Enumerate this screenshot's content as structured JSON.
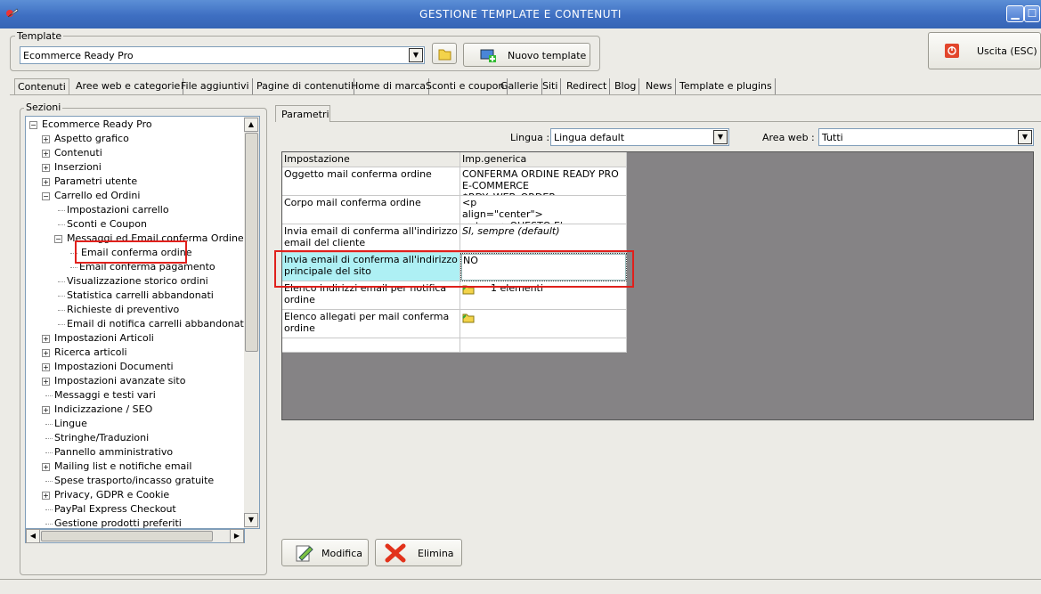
{
  "window": {
    "title": "GESTIONE TEMPLATE E CONTENUTI"
  },
  "template": {
    "group_label": "Template",
    "selected": "Ecommerce Ready Pro",
    "new_button": "Nuovo template"
  },
  "exit_button": "Uscita (ESC)",
  "tabs": [
    "Contenuti",
    "Aree web e categorie",
    "File aggiuntivi",
    "Pagine di contenuti",
    "Home di marca",
    "Sconti e coupon",
    "Gallerie",
    "Siti",
    "Redirect",
    "Blog",
    "News",
    "Template e plugins"
  ],
  "sections": {
    "label": "Sezioni",
    "tree": [
      {
        "label": "Ecommerce Ready Pro",
        "level": 0,
        "expander": "-"
      },
      {
        "label": "Aspetto grafico",
        "level": 1,
        "expander": "+"
      },
      {
        "label": "Contenuti",
        "level": 1,
        "expander": "+"
      },
      {
        "label": "Inserzioni",
        "level": 1,
        "expander": "+"
      },
      {
        "label": "Parametri utente",
        "level": 1,
        "expander": "+"
      },
      {
        "label": "Carrello ed Ordini",
        "level": 1,
        "expander": "-"
      },
      {
        "label": "Impostazioni carrello",
        "level": 2,
        "expander": ""
      },
      {
        "label": "Sconti e Coupon",
        "level": 2,
        "expander": ""
      },
      {
        "label": "Messaggi ed Email conferma Ordine",
        "level": 2,
        "expander": "-"
      },
      {
        "label": "Email conferma ordine",
        "level": 3,
        "expander": "",
        "selected": true
      },
      {
        "label": "Email conferma pagamento",
        "level": 3,
        "expander": ""
      },
      {
        "label": "Visualizzazione storico ordini",
        "level": 2,
        "expander": ""
      },
      {
        "label": "Statistica carrelli abbandonati",
        "level": 2,
        "expander": ""
      },
      {
        "label": "Richieste di preventivo",
        "level": 2,
        "expander": ""
      },
      {
        "label": "Email di notifica carrelli abbandonati",
        "level": 2,
        "expander": ""
      },
      {
        "label": "Impostazioni Articoli",
        "level": 1,
        "expander": "+"
      },
      {
        "label": "Ricerca articoli",
        "level": 1,
        "expander": "+"
      },
      {
        "label": "Impostazioni Documenti",
        "level": 1,
        "expander": "+"
      },
      {
        "label": "Impostazioni avanzate sito",
        "level": 1,
        "expander": "+"
      },
      {
        "label": "Messaggi e testi vari",
        "level": 1,
        "expander": ""
      },
      {
        "label": "Indicizzazione / SEO",
        "level": 1,
        "expander": "+"
      },
      {
        "label": "Lingue",
        "level": 1,
        "expander": ""
      },
      {
        "label": "Stringhe/Traduzioni",
        "level": 1,
        "expander": ""
      },
      {
        "label": "Pannello amministrativo",
        "level": 1,
        "expander": ""
      },
      {
        "label": "Mailing list e notifiche email",
        "level": 1,
        "expander": "+"
      },
      {
        "label": "Spese trasporto/incasso gratuite",
        "level": 1,
        "expander": ""
      },
      {
        "label": "Privacy, GDPR e Cookie",
        "level": 1,
        "expander": "+"
      },
      {
        "label": "PayPal Express Checkout",
        "level": 1,
        "expander": ""
      },
      {
        "label": "Gestione prodotti preferiti",
        "level": 1,
        "expander": ""
      }
    ]
  },
  "params": {
    "tab": "Parametri",
    "lingua_label": "Lingua :",
    "lingua_value": "Lingua default",
    "area_label": "Area web :",
    "area_value": "Tutti",
    "col1": "Impostazione",
    "col2": "Imp.generica",
    "rows": [
      {
        "name": "Oggetto mail conferma ordine",
        "value": "CONFERMA ORDINE READY PRO\nE-COMMERCE $RDY_WEB_ORDER...",
        "icon": ""
      },
      {
        "name": "Corpo mail conferma ordine",
        "value": "<p\nalign=\"center\"><strong>QUESTO E'",
        "icon": ""
      },
      {
        "name": "Invia email di conferma all'indirizzo email del cliente",
        "value": "SI, sempre (default)",
        "icon": ""
      },
      {
        "name": "Invia email di conferma all'indirizzo principale del sito",
        "value": "NO",
        "icon": ""
      },
      {
        "name": "Elenco indirizzi email per notifica ordine",
        "value": "1 elementi",
        "icon": "folder-icon"
      },
      {
        "name": "Elenco allegati per mail conferma ordine",
        "value": "",
        "icon": "folder-icon"
      },
      {
        "name": "",
        "value": "",
        "icon": ""
      }
    ]
  },
  "buttons": {
    "modifica": "Modifica",
    "elimina": "Elimina"
  }
}
